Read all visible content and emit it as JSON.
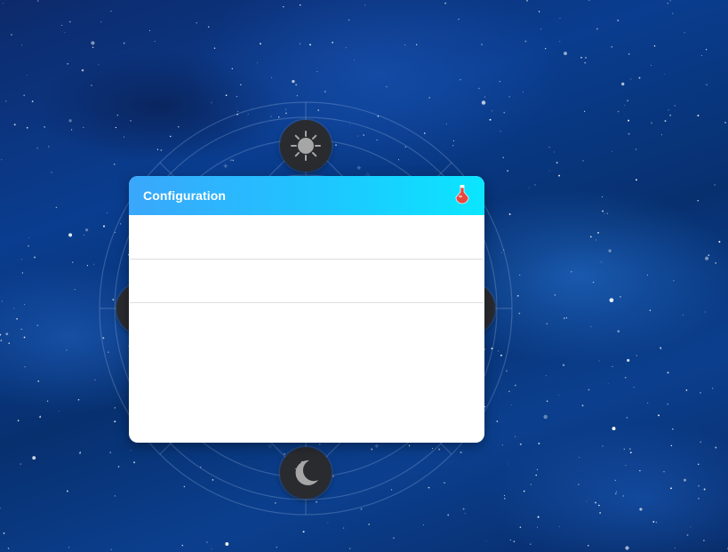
{
  "panel": {
    "title": "Configuration",
    "rows": [
      "",
      ""
    ]
  },
  "icons": {
    "top_orb": "sun-icon",
    "bottom_orb": "moon-icon",
    "left_orb": "orb-icon",
    "right_orb": "orb-icon",
    "header_action": "potion-flask-icon"
  },
  "colors": {
    "header_gradient_start": "#3aa7fb",
    "header_gradient_end": "#0be6ff",
    "panel_background": "#ffffff",
    "potion_red": "#e8473f",
    "orb_dark": "#2a2b2f",
    "orb_glyph": "#a6a6a6",
    "sky_blue": "#0a3d8f"
  }
}
